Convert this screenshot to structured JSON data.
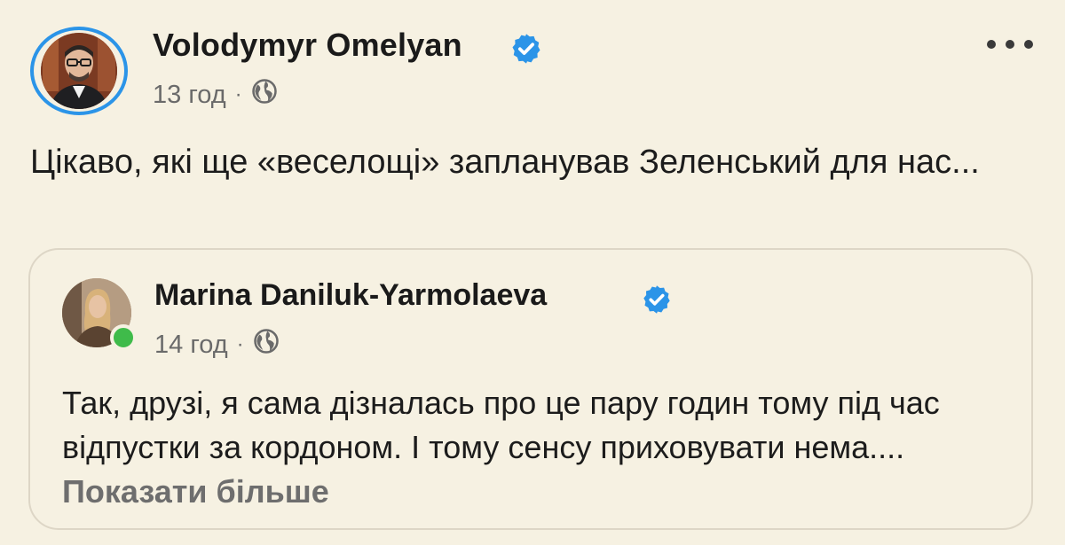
{
  "post": {
    "author": "Volodymyr Omelyan",
    "time": "13 год",
    "separator": "·",
    "text": "Цікаво, які ще «веселощі» запланував Зеленський для нас..."
  },
  "shared": {
    "author": "Marina Daniluk-Yarmolaeva",
    "time": "14 год",
    "separator": "·",
    "text": "Так, друзі, я сама дізналась про це пару годин тому під час відпустки за кордоном. І тому сенсу приховувати нема....",
    "see_more": "Показати більше"
  },
  "colors": {
    "background": "#f6f1e2",
    "verified_badge": "#2b94e8",
    "online": "#3fbb4a",
    "muted_text": "#6a6a6a"
  },
  "icons": {
    "verified": "verified-badge-icon",
    "audience": "globe-icon",
    "more": "more-options-icon"
  }
}
